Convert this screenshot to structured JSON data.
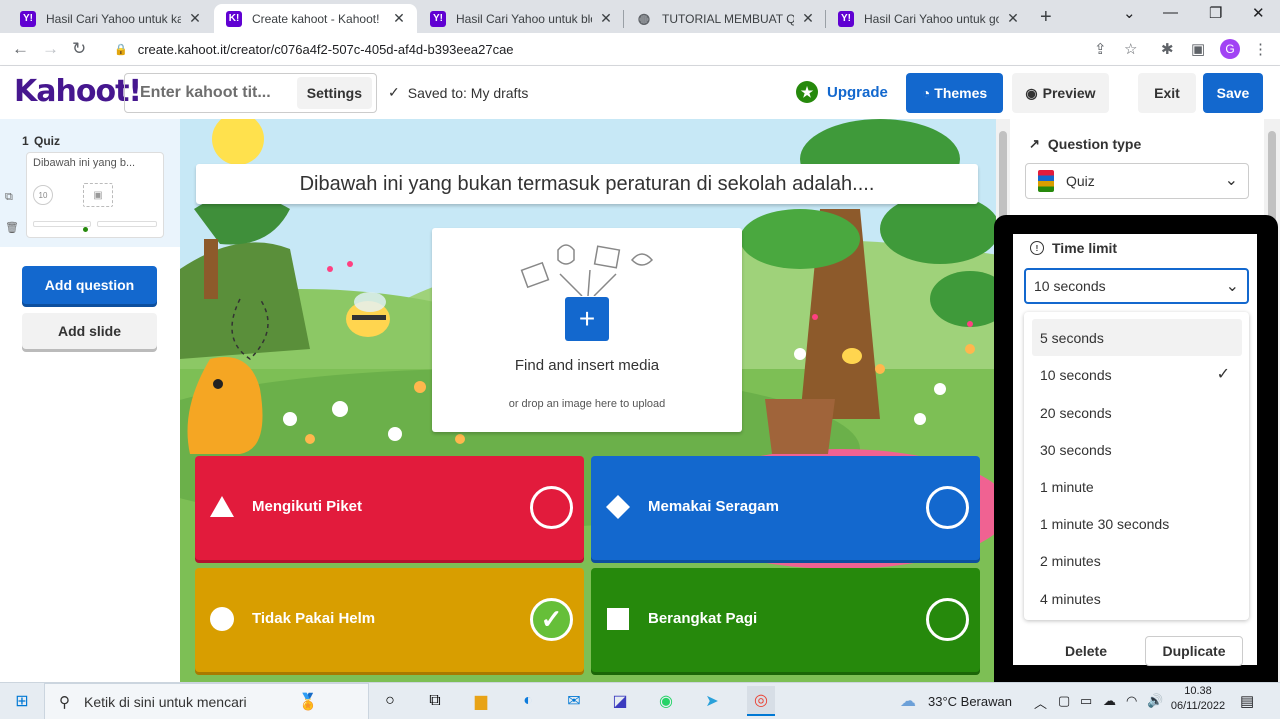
{
  "browser": {
    "tabs": [
      {
        "title": "Hasil Cari Yahoo untuk kahoot",
        "favicon": "Y!"
      },
      {
        "title": "Create kahoot - Kahoot!",
        "favicon": "K!"
      },
      {
        "title": "Hasil Cari Yahoo untuk blog c",
        "favicon": "Y!"
      },
      {
        "title": "TUTORIAL MEMBUAT QUIS C",
        "favicon": "globe"
      },
      {
        "title": "Hasil Cari Yahoo untuk goog",
        "favicon": "Y!"
      }
    ],
    "url": "create.kahoot.it/creator/c076a4f2-507c-405d-af4d-b393eea27cae",
    "profile_initial": "G"
  },
  "header": {
    "logo": "Kahoot!",
    "title_placeholder": "Enter kahoot tit...",
    "settings_label": "Settings",
    "saved_text": "Saved to: My drafts",
    "upgrade_label": "Upgrade",
    "themes_label": "Themes",
    "preview_label": "Preview",
    "exit_label": "Exit",
    "save_label": "Save"
  },
  "sidebar": {
    "slide_number": "1",
    "slide_type": "Quiz",
    "slide_preview_text": "Dibawah ini yang b...",
    "slide_time": "10",
    "add_question_label": "Add question",
    "add_slide_label": "Add slide"
  },
  "editor": {
    "question": "Dibawah ini yang bukan termasuk peraturan di sekolah adalah....",
    "media_title": "Find and insert media",
    "media_subtitle": "or drop an image here to upload",
    "answers": [
      {
        "text": "Mengikuti Piket",
        "shape": "triangle",
        "color": "#e21b3c",
        "correct": false
      },
      {
        "text": "Memakai Seragam",
        "shape": "diamond",
        "color": "#1368ce",
        "correct": false
      },
      {
        "text": "Tidak Pakai Helm",
        "shape": "circle",
        "color": "#d89e00",
        "correct": true
      },
      {
        "text": "Berangkat Pagi",
        "shape": "square",
        "color": "#26890c",
        "correct": false
      }
    ]
  },
  "panel": {
    "question_type_label": "Question type",
    "question_type_value": "Quiz",
    "time_limit_label": "Time limit",
    "time_limit_value": "10 seconds",
    "time_options": [
      "5 seconds",
      "10 seconds",
      "20 seconds",
      "30 seconds",
      "1 minute",
      "1 minute 30 seconds",
      "2 minutes",
      "4 minutes"
    ],
    "selected_option_index": 1,
    "delete_label": "Delete",
    "duplicate_label": "Duplicate"
  },
  "taskbar": {
    "search_placeholder": "Ketik di sini untuk mencari",
    "weather": "33°C  Berawan",
    "time": "10.38",
    "date": "06/11/2022"
  }
}
